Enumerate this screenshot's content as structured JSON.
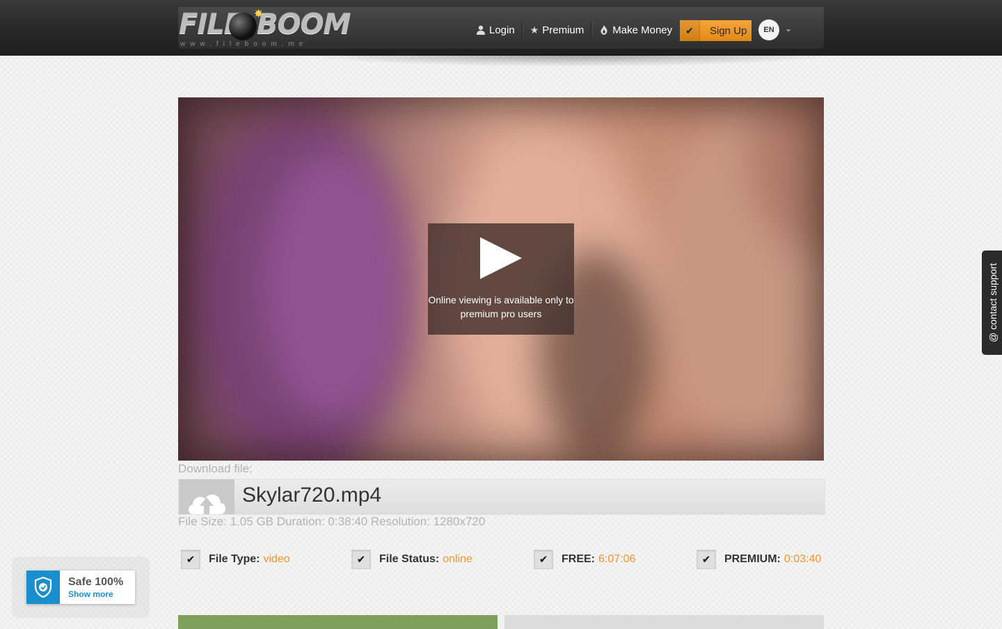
{
  "brand": {
    "logo_text_1": "FILE",
    "logo_text_2": "BOOM",
    "logo_url": "www.fileboom.me",
    "accent": "#f0962c"
  },
  "nav": {
    "login": "Login",
    "premium": "Premium",
    "make_money": "Make Money",
    "signup": "Sign Up",
    "language": "EN"
  },
  "video": {
    "message": "Online viewing is available only to premium pro users"
  },
  "download": {
    "label": "Download file:",
    "file_name": "Skylar720.mp4",
    "meta": "File Size: 1.05 GB Duration: 0:38:40 Resolution: 1280x720"
  },
  "stats": [
    {
      "key": "File Type:",
      "value": "video"
    },
    {
      "key": "File Status:",
      "value": "online"
    },
    {
      "key": "FREE:",
      "value": "6:07:06"
    },
    {
      "key": "PREMIUM:",
      "value": "0:03:40"
    }
  ],
  "safe_badge": {
    "title": "Safe 100%",
    "link": "Show more"
  },
  "support": {
    "label": "@ contact support"
  }
}
